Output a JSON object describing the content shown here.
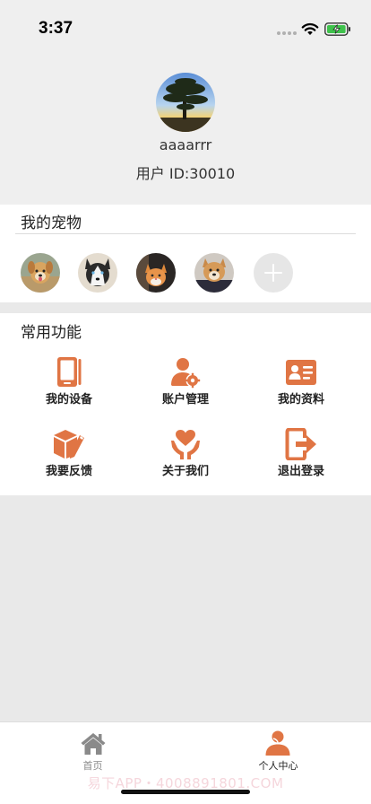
{
  "status_bar": {
    "time": "3:37"
  },
  "profile": {
    "username": "aaaarrr",
    "user_id": "用户 ID:30010"
  },
  "pets": {
    "title": "我的宠物",
    "items": [
      {
        "name": "pet-dog-1"
      },
      {
        "name": "pet-husky"
      },
      {
        "name": "pet-cat"
      },
      {
        "name": "pet-dog-2"
      }
    ]
  },
  "functions": {
    "title": "常用功能",
    "items": [
      {
        "label": "我的设备",
        "icon": "device-icon"
      },
      {
        "label": "账户管理",
        "icon": "account-settings-icon"
      },
      {
        "label": "我的资料",
        "icon": "profile-card-icon"
      },
      {
        "label": "我要反馈",
        "icon": "feedback-icon"
      },
      {
        "label": "关于我们",
        "icon": "about-heart-icon"
      },
      {
        "label": "退出登录",
        "icon": "logout-icon"
      }
    ]
  },
  "tabs": [
    {
      "label": "首页",
      "icon": "home-icon",
      "active": false
    },
    {
      "label": "个人中心",
      "icon": "person-icon",
      "active": true
    }
  ],
  "watermark": "易下APP・4008891801.COM",
  "colors": {
    "accent": "#e07544",
    "background": "#e9e9e9",
    "header": "#efefef"
  }
}
